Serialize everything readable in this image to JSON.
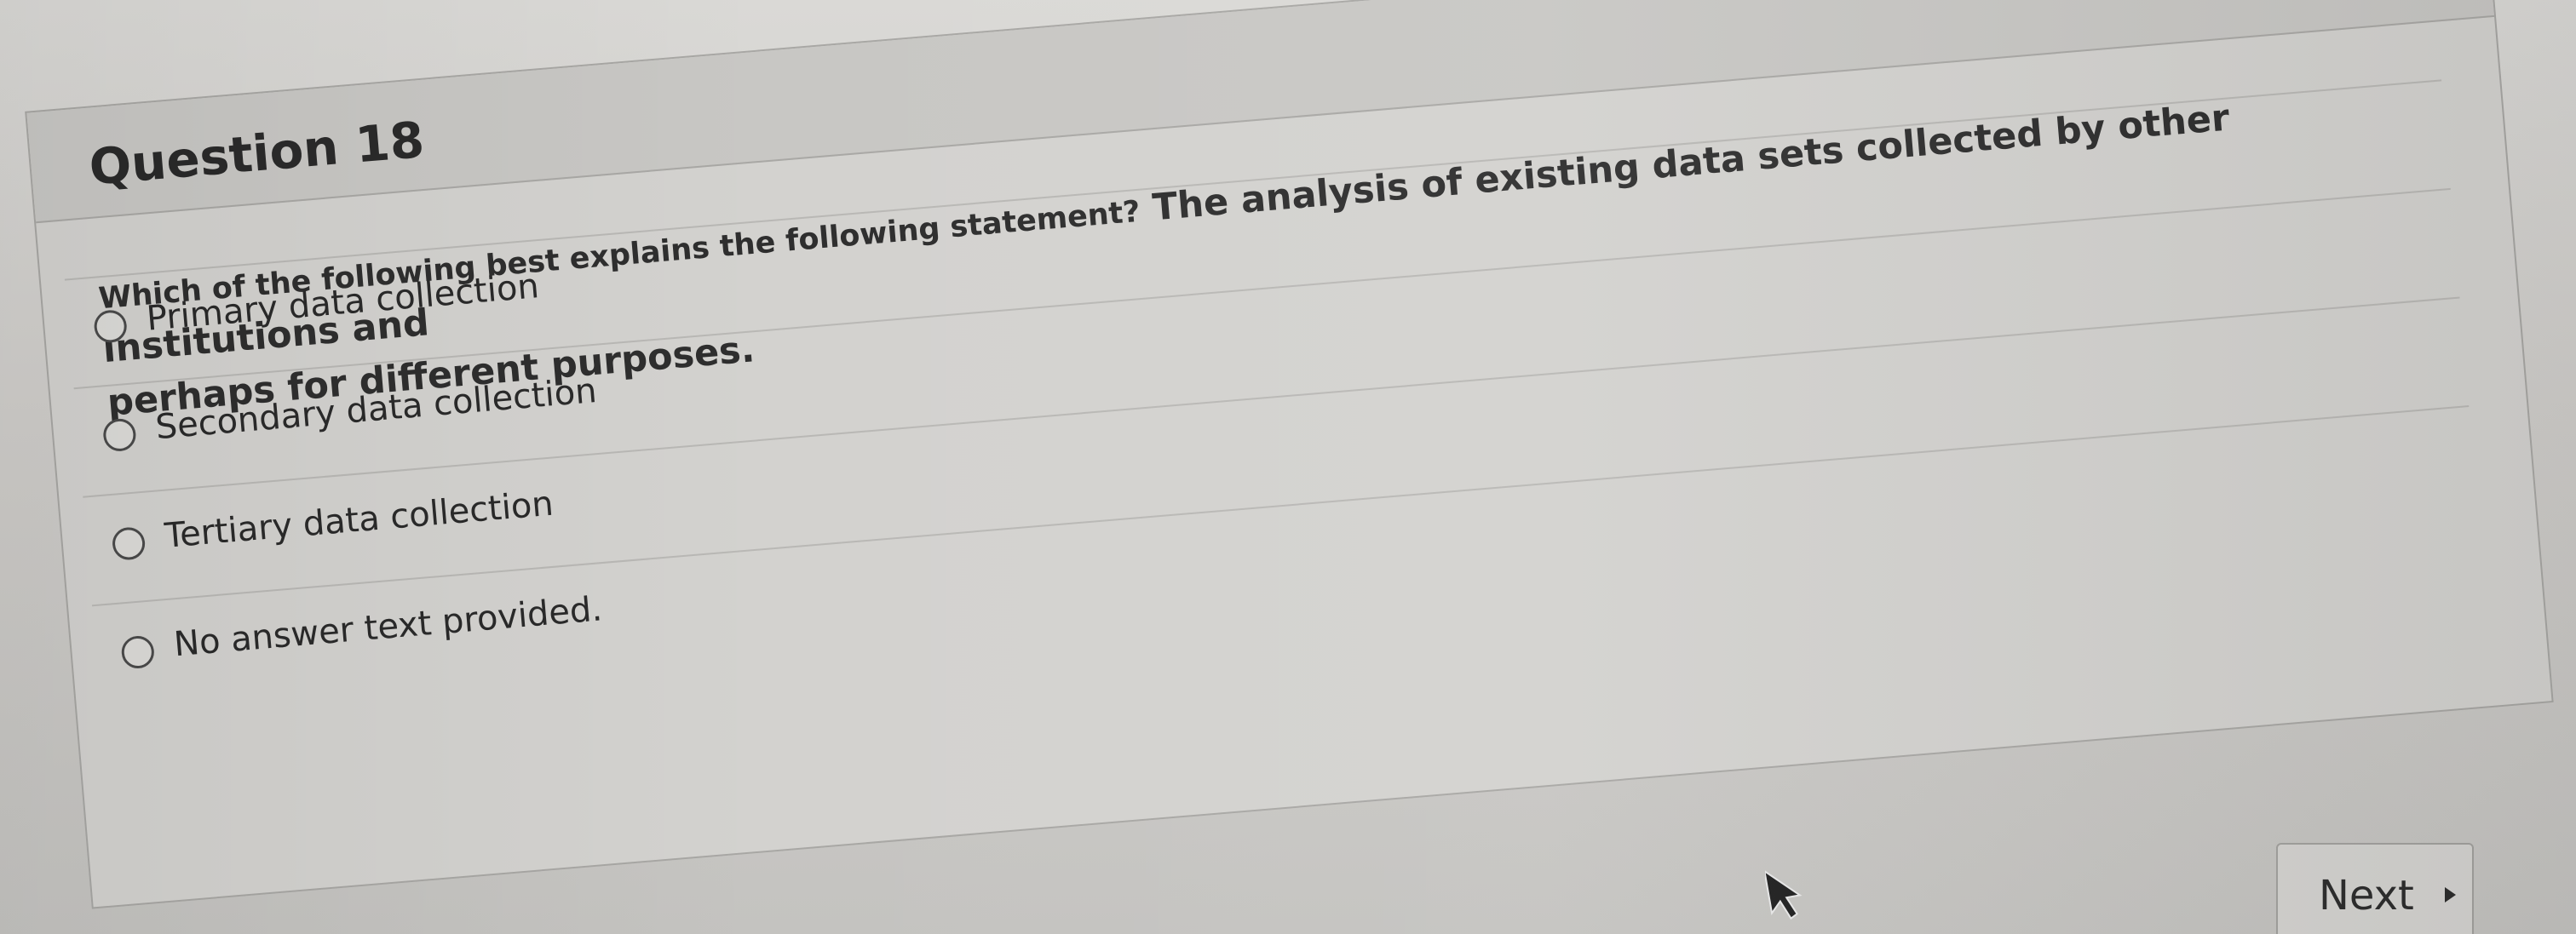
{
  "question": {
    "title": "Question 18",
    "prompt_part1": "Which of the following best explains the following statement?",
    "prompt_part2": " The analysis of existing data sets collected by other institutions and",
    "prompt_line2": "perhaps for different purposes."
  },
  "answers": [
    {
      "label": "Primary data collection"
    },
    {
      "label": "Secondary data collection"
    },
    {
      "label": "Tertiary data collection"
    },
    {
      "label": "No answer text provided."
    }
  ],
  "navigation": {
    "next_label": "Next",
    "next_icon": "triangle-right-icon"
  },
  "colors": {
    "background": "#cfcdca",
    "text": "#2a2a2a",
    "border": "#a8a7a4"
  }
}
